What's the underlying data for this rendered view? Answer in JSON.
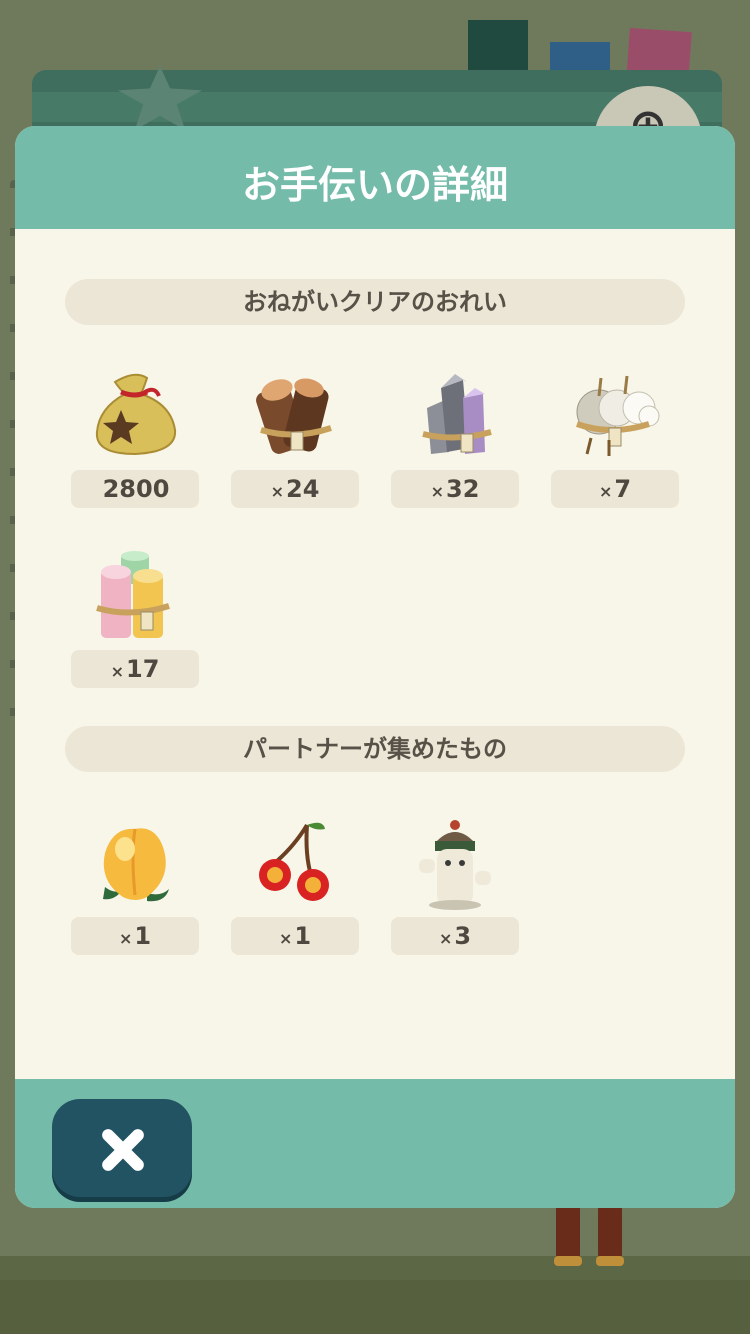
{
  "dialog": {
    "title": "お手伝いの詳細",
    "close_icon": "close-icon"
  },
  "sections": [
    {
      "title": "おねがいクリアのおれい",
      "items": [
        {
          "icon": "bell-bag-icon",
          "prefix": "",
          "qty": "2800"
        },
        {
          "icon": "wood-bundle-icon",
          "prefix": "×",
          "qty": "24"
        },
        {
          "icon": "steel-bundle-icon",
          "prefix": "×",
          "qty": "32"
        },
        {
          "icon": "cotton-bundle-icon",
          "prefix": "×",
          "qty": "7"
        },
        {
          "icon": "paper-bundle-icon",
          "prefix": "×",
          "qty": "17"
        }
      ]
    },
    {
      "title": "パートナーが集めたもの",
      "items": [
        {
          "icon": "peach-icon",
          "prefix": "×",
          "qty": "1"
        },
        {
          "icon": "cherry-icon",
          "prefix": "×",
          "qty": "1"
        },
        {
          "icon": "cactus-item-icon",
          "prefix": "×",
          "qty": "3"
        }
      ]
    }
  ],
  "colors": {
    "header": "#74bba9",
    "panel": "#f8f5e9",
    "pill": "#ece6d6",
    "close_button": "#225363"
  }
}
